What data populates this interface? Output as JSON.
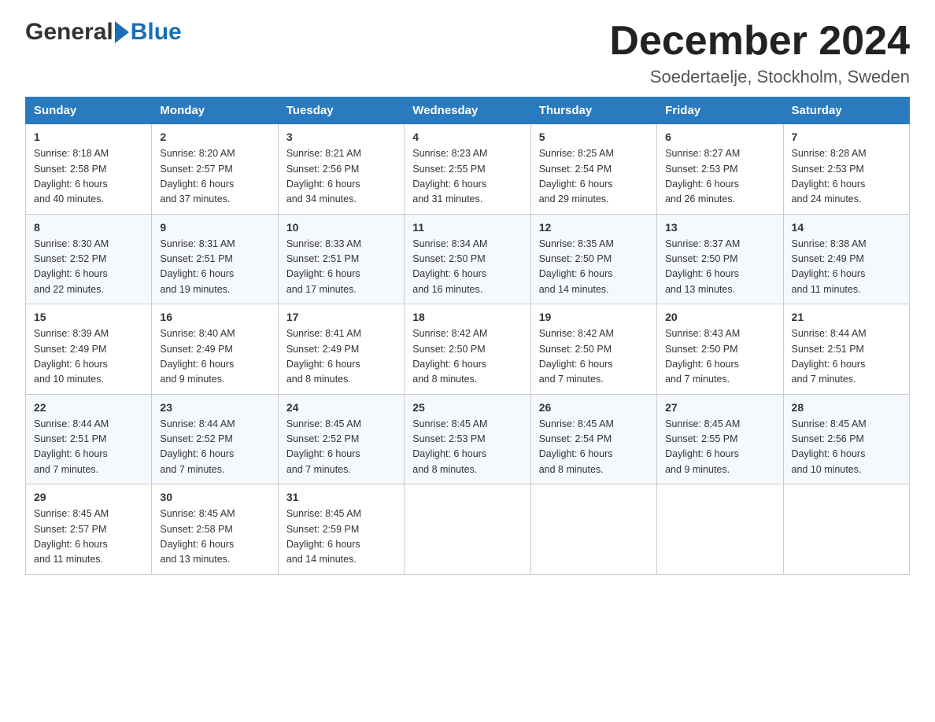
{
  "header": {
    "logo_general": "General",
    "logo_blue": "Blue",
    "month_title": "December 2024",
    "location": "Soedertaelje, Stockholm, Sweden"
  },
  "weekdays": [
    "Sunday",
    "Monday",
    "Tuesday",
    "Wednesday",
    "Thursday",
    "Friday",
    "Saturday"
  ],
  "weeks": [
    [
      {
        "day": "1",
        "sunrise": "8:18 AM",
        "sunset": "2:58 PM",
        "daylight": "6 hours and 40 minutes."
      },
      {
        "day": "2",
        "sunrise": "8:20 AM",
        "sunset": "2:57 PM",
        "daylight": "6 hours and 37 minutes."
      },
      {
        "day": "3",
        "sunrise": "8:21 AM",
        "sunset": "2:56 PM",
        "daylight": "6 hours and 34 minutes."
      },
      {
        "day": "4",
        "sunrise": "8:23 AM",
        "sunset": "2:55 PM",
        "daylight": "6 hours and 31 minutes."
      },
      {
        "day": "5",
        "sunrise": "8:25 AM",
        "sunset": "2:54 PM",
        "daylight": "6 hours and 29 minutes."
      },
      {
        "day": "6",
        "sunrise": "8:27 AM",
        "sunset": "2:53 PM",
        "daylight": "6 hours and 26 minutes."
      },
      {
        "day": "7",
        "sunrise": "8:28 AM",
        "sunset": "2:53 PM",
        "daylight": "6 hours and 24 minutes."
      }
    ],
    [
      {
        "day": "8",
        "sunrise": "8:30 AM",
        "sunset": "2:52 PM",
        "daylight": "6 hours and 22 minutes."
      },
      {
        "day": "9",
        "sunrise": "8:31 AM",
        "sunset": "2:51 PM",
        "daylight": "6 hours and 19 minutes."
      },
      {
        "day": "10",
        "sunrise": "8:33 AM",
        "sunset": "2:51 PM",
        "daylight": "6 hours and 17 minutes."
      },
      {
        "day": "11",
        "sunrise": "8:34 AM",
        "sunset": "2:50 PM",
        "daylight": "6 hours and 16 minutes."
      },
      {
        "day": "12",
        "sunrise": "8:35 AM",
        "sunset": "2:50 PM",
        "daylight": "6 hours and 14 minutes."
      },
      {
        "day": "13",
        "sunrise": "8:37 AM",
        "sunset": "2:50 PM",
        "daylight": "6 hours and 13 minutes."
      },
      {
        "day": "14",
        "sunrise": "8:38 AM",
        "sunset": "2:49 PM",
        "daylight": "6 hours and 11 minutes."
      }
    ],
    [
      {
        "day": "15",
        "sunrise": "8:39 AM",
        "sunset": "2:49 PM",
        "daylight": "6 hours and 10 minutes."
      },
      {
        "day": "16",
        "sunrise": "8:40 AM",
        "sunset": "2:49 PM",
        "daylight": "6 hours and 9 minutes."
      },
      {
        "day": "17",
        "sunrise": "8:41 AM",
        "sunset": "2:49 PM",
        "daylight": "6 hours and 8 minutes."
      },
      {
        "day": "18",
        "sunrise": "8:42 AM",
        "sunset": "2:50 PM",
        "daylight": "6 hours and 8 minutes."
      },
      {
        "day": "19",
        "sunrise": "8:42 AM",
        "sunset": "2:50 PM",
        "daylight": "6 hours and 7 minutes."
      },
      {
        "day": "20",
        "sunrise": "8:43 AM",
        "sunset": "2:50 PM",
        "daylight": "6 hours and 7 minutes."
      },
      {
        "day": "21",
        "sunrise": "8:44 AM",
        "sunset": "2:51 PM",
        "daylight": "6 hours and 7 minutes."
      }
    ],
    [
      {
        "day": "22",
        "sunrise": "8:44 AM",
        "sunset": "2:51 PM",
        "daylight": "6 hours and 7 minutes."
      },
      {
        "day": "23",
        "sunrise": "8:44 AM",
        "sunset": "2:52 PM",
        "daylight": "6 hours and 7 minutes."
      },
      {
        "day": "24",
        "sunrise": "8:45 AM",
        "sunset": "2:52 PM",
        "daylight": "6 hours and 7 minutes."
      },
      {
        "day": "25",
        "sunrise": "8:45 AM",
        "sunset": "2:53 PM",
        "daylight": "6 hours and 8 minutes."
      },
      {
        "day": "26",
        "sunrise": "8:45 AM",
        "sunset": "2:54 PM",
        "daylight": "6 hours and 8 minutes."
      },
      {
        "day": "27",
        "sunrise": "8:45 AM",
        "sunset": "2:55 PM",
        "daylight": "6 hours and 9 minutes."
      },
      {
        "day": "28",
        "sunrise": "8:45 AM",
        "sunset": "2:56 PM",
        "daylight": "6 hours and 10 minutes."
      }
    ],
    [
      {
        "day": "29",
        "sunrise": "8:45 AM",
        "sunset": "2:57 PM",
        "daylight": "6 hours and 11 minutes."
      },
      {
        "day": "30",
        "sunrise": "8:45 AM",
        "sunset": "2:58 PM",
        "daylight": "6 hours and 13 minutes."
      },
      {
        "day": "31",
        "sunrise": "8:45 AM",
        "sunset": "2:59 PM",
        "daylight": "6 hours and 14 minutes."
      },
      null,
      null,
      null,
      null
    ]
  ],
  "labels": {
    "sunrise": "Sunrise:",
    "sunset": "Sunset:",
    "daylight": "Daylight:"
  }
}
